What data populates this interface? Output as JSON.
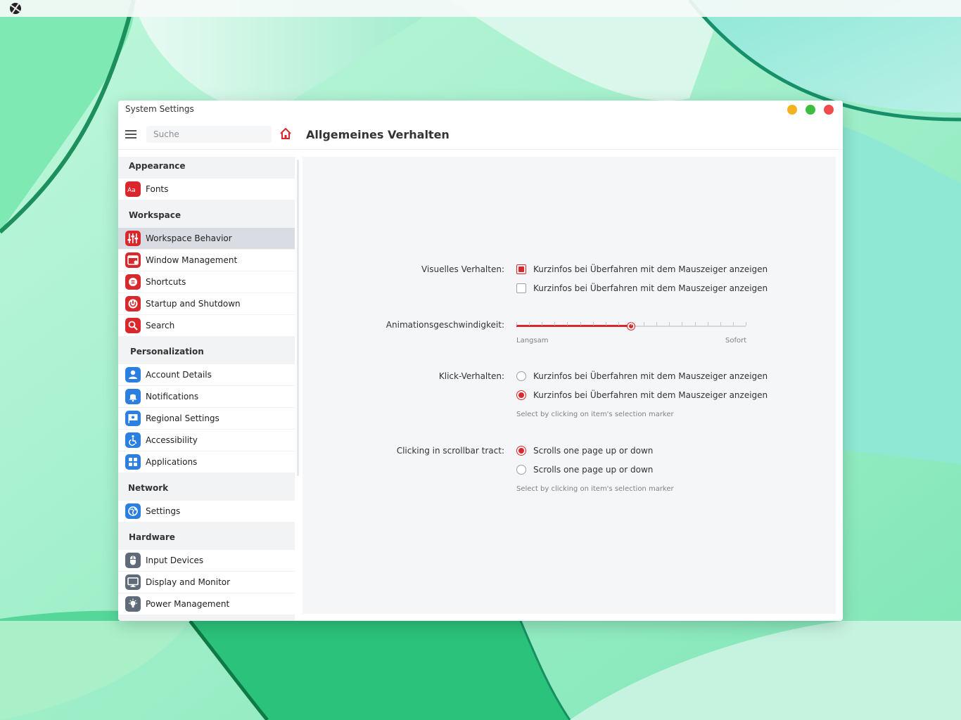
{
  "window": {
    "title": "System Settings",
    "accent_color": "#d9272c"
  },
  "toolbar": {
    "search_placeholder": "Suche",
    "page_title": "Allgemeines Verhalten"
  },
  "sidebar": {
    "sections": [
      {
        "header": "Appearance",
        "items": [
          {
            "label": "Fonts",
            "icon": "fonts-icon"
          }
        ]
      },
      {
        "header": "Workspace",
        "items": [
          {
            "label": "Workspace Behavior",
            "icon": "sliders-icon",
            "selected": true
          },
          {
            "label": "Window Management",
            "icon": "window-icon"
          },
          {
            "label": "Shortcuts",
            "icon": "shortcuts-icon"
          },
          {
            "label": "Startup and Shutdown",
            "icon": "power-icon"
          },
          {
            "label": "Search",
            "icon": "search-icon"
          }
        ]
      },
      {
        "header": "Personalization",
        "items": [
          {
            "label": "Account Details",
            "icon": "user-icon"
          },
          {
            "label": "Notifications",
            "icon": "bell-icon"
          },
          {
            "label": "Regional Settings",
            "icon": "flag-icon"
          },
          {
            "label": "Accessibility",
            "icon": "accessibility-icon"
          },
          {
            "label": "Applications",
            "icon": "apps-grid-icon"
          }
        ]
      },
      {
        "header": "Network",
        "items": [
          {
            "label": "Settings",
            "icon": "globe-icon"
          }
        ]
      },
      {
        "header": "Hardware",
        "items": [
          {
            "label": "Input Devices",
            "icon": "mouse-icon"
          },
          {
            "label": "Display and Monitor",
            "icon": "monitor-icon"
          },
          {
            "label": "Power Management",
            "icon": "bulb-icon"
          }
        ]
      }
    ]
  },
  "content": {
    "visual": {
      "label": "Visuelles Verhalten:",
      "options": [
        {
          "text": "Kurzinfos bei Überfahren mit dem Mauszeiger anzeigen",
          "checked": true
        },
        {
          "text": "Kurzinfos bei Überfahren mit dem Mauszeiger anzeigen",
          "checked": false
        }
      ]
    },
    "animation": {
      "label": "Animationsgeschwindigkeit:",
      "value_fraction": 0.5,
      "min_label": "Langsam",
      "max_label": "Sofort"
    },
    "click": {
      "label": "Klick-Verhalten:",
      "options": [
        {
          "text": "Kurzinfos bei Überfahren mit dem Mauszeiger anzeigen",
          "selected": false
        },
        {
          "text": "Kurzinfos bei Überfahren mit dem Mauszeiger anzeigen",
          "selected": true
        }
      ],
      "hint": "Select by clicking on item's selection marker"
    },
    "scrollbar": {
      "label": "Clicking in scrollbar tract:",
      "options": [
        {
          "text": "Scrolls one page up or down",
          "selected": true
        },
        {
          "text": "Scrolls one page up or down",
          "selected": false
        }
      ],
      "hint": "Select by clicking on item's selection marker"
    }
  }
}
